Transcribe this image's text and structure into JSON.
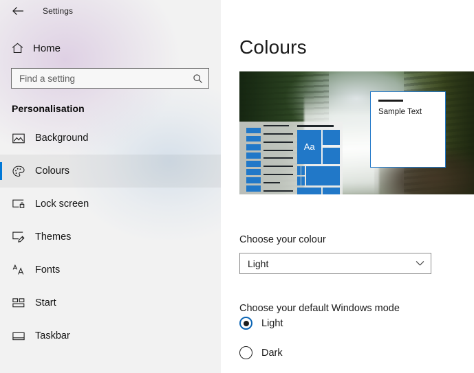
{
  "window": {
    "app_title": "Settings",
    "back_icon": "back-arrow-icon"
  },
  "sidebar": {
    "home_label": "Home",
    "home_icon": "home-icon",
    "search": {
      "placeholder": "Find a setting",
      "value": "",
      "icon": "search-icon"
    },
    "section_title": "Personalisation",
    "items": [
      {
        "label": "Background",
        "icon": "picture-icon",
        "selected": false
      },
      {
        "label": "Colours",
        "icon": "palette-icon",
        "selected": true
      },
      {
        "label": "Lock screen",
        "icon": "lock-screen-icon",
        "selected": false
      },
      {
        "label": "Themes",
        "icon": "paintbrush-icon",
        "selected": false
      },
      {
        "label": "Fonts",
        "icon": "fonts-aa-icon",
        "selected": false
      },
      {
        "label": "Start",
        "icon": "start-tiles-icon",
        "selected": false
      },
      {
        "label": "Taskbar",
        "icon": "taskbar-icon",
        "selected": false
      }
    ]
  },
  "main": {
    "page_title": "Colours",
    "preview": {
      "name": "colour-preview",
      "wallpaper_description": "Waterfall and forest landscape photo",
      "sample_window_text": "Sample Text",
      "tile_letter": "Aa",
      "accent_colour": "#2178C8"
    },
    "colour_section": {
      "label": "Choose your colour",
      "dropdown_value": "Light",
      "chevron_icon": "chevron-down-icon"
    },
    "mode_section": {
      "label": "Choose your default Windows mode",
      "options": [
        {
          "label": "Light",
          "checked": true
        },
        {
          "label": "Dark",
          "checked": false
        }
      ]
    }
  },
  "colors": {
    "accent": "#0078D7",
    "tile_blue": "#2178C8",
    "radio_ring": "#0A64B4",
    "sidebar_bg": "#F2F2F2"
  }
}
